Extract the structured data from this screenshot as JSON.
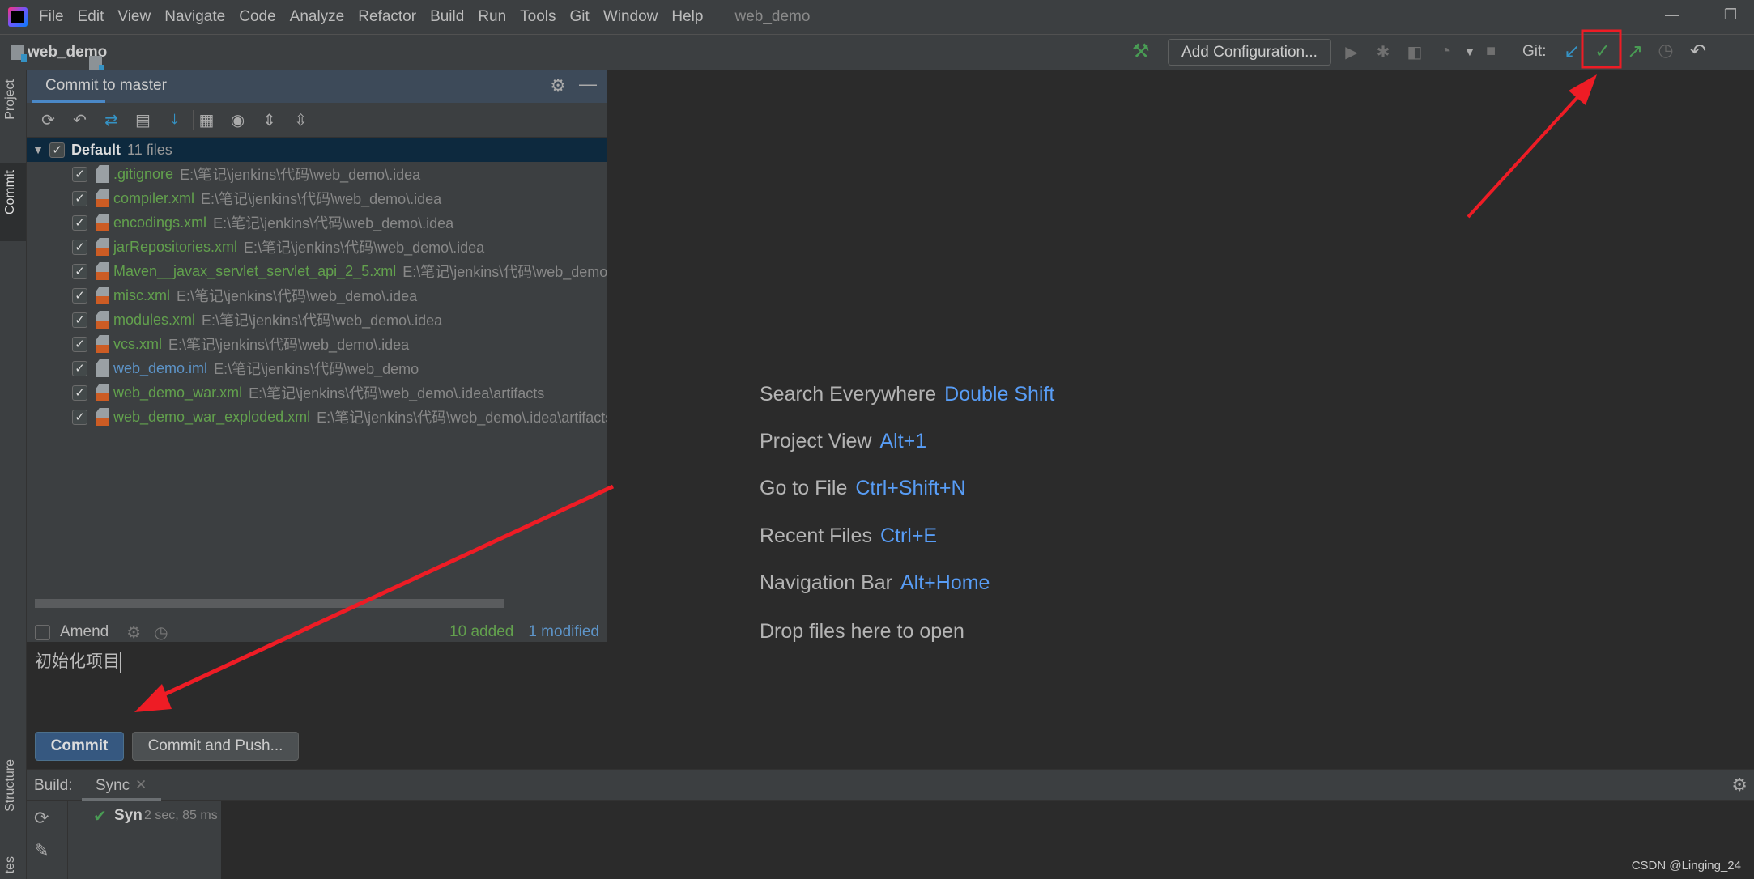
{
  "menubar": {
    "items": [
      "File",
      "Edit",
      "View",
      "Navigate",
      "Code",
      "Analyze",
      "Refactor",
      "Build",
      "Run",
      "Tools",
      "Git",
      "Window",
      "Help"
    ],
    "window_title": "web_demo"
  },
  "navbar": {
    "project": "web_demo",
    "add_configuration": "Add Configuration...",
    "git_label": "Git:"
  },
  "left_strip": {
    "tabs": [
      "Project",
      "Commit",
      "Structure",
      "tes"
    ]
  },
  "commit_panel": {
    "title": "Commit to master",
    "group": {
      "name": "Default",
      "count": "11 files"
    },
    "files": [
      {
        "name": ".gitignore",
        "path": "E:\\笔记\\jenkins\\代码\\web_demo\\.idea",
        "status": "added",
        "icon": "ignore-file-icon"
      },
      {
        "name": "compiler.xml",
        "path": "E:\\笔记\\jenkins\\代码\\web_demo\\.idea",
        "status": "added",
        "icon": "xml-file-icon"
      },
      {
        "name": "encodings.xml",
        "path": "E:\\笔记\\jenkins\\代码\\web_demo\\.idea",
        "status": "added",
        "icon": "xml-file-icon"
      },
      {
        "name": "jarRepositories.xml",
        "path": "E:\\笔记\\jenkins\\代码\\web_demo\\.idea",
        "status": "added",
        "icon": "xml-file-icon"
      },
      {
        "name": "Maven__javax_servlet_servlet_api_2_5.xml",
        "path": "E:\\笔记\\jenkins\\代码\\web_demo\\.idea\\libraries",
        "status": "added",
        "icon": "xml-file-icon"
      },
      {
        "name": "misc.xml",
        "path": "E:\\笔记\\jenkins\\代码\\web_demo\\.idea",
        "status": "added",
        "icon": "xml-file-icon"
      },
      {
        "name": "modules.xml",
        "path": "E:\\笔记\\jenkins\\代码\\web_demo\\.idea",
        "status": "added",
        "icon": "xml-file-icon"
      },
      {
        "name": "vcs.xml",
        "path": "E:\\笔记\\jenkins\\代码\\web_demo\\.idea",
        "status": "added",
        "icon": "xml-file-icon"
      },
      {
        "name": "web_demo.iml",
        "path": "E:\\笔记\\jenkins\\代码\\web_demo",
        "status": "modified",
        "icon": "module-file-icon"
      },
      {
        "name": "web_demo_war.xml",
        "path": "E:\\笔记\\jenkins\\代码\\web_demo\\.idea\\artifacts",
        "status": "added",
        "icon": "xml-file-icon"
      },
      {
        "name": "web_demo_war_exploded.xml",
        "path": "E:\\笔记\\jenkins\\代码\\web_demo\\.idea\\artifacts",
        "status": "added",
        "icon": "xml-file-icon"
      }
    ],
    "amend_label": "Amend",
    "added_count": "10 added",
    "modified_count": "1 modified",
    "message": "初始化项目",
    "commit_button": "Commit",
    "commit_push_button": "Commit and Push..."
  },
  "welcome": [
    {
      "label": "Search Everywhere",
      "key": "Double Shift"
    },
    {
      "label": "Project View",
      "key": "Alt+1"
    },
    {
      "label": "Go to File",
      "key": "Ctrl+Shift+N"
    },
    {
      "label": "Recent Files",
      "key": "Ctrl+E"
    },
    {
      "label": "Navigation Bar",
      "key": "Alt+Home"
    },
    {
      "label": "Drop files here to open",
      "key": ""
    }
  ],
  "build": {
    "label": "Build:",
    "tab": "Sync",
    "item": "Syn",
    "duration": "2 sec, 85 ms"
  },
  "watermark": "CSDN @Linging_24",
  "colors": {
    "added": "#62a04d",
    "modified": "#5d94c8",
    "accent": "#4a88c7",
    "annotation": "#ee1c25"
  }
}
